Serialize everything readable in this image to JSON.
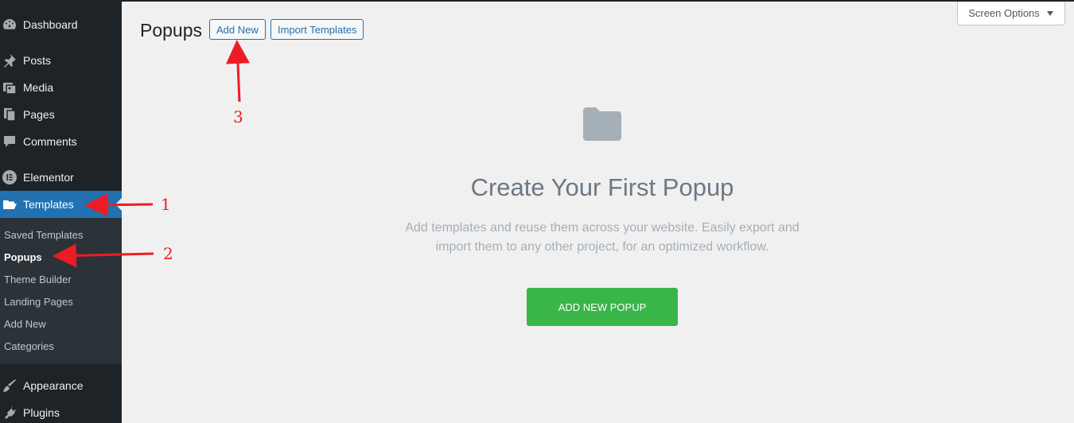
{
  "sidebar": {
    "items": [
      {
        "label": "Dashboard",
        "icon": "dashboard-icon"
      },
      {
        "label": "Posts",
        "icon": "pin-icon"
      },
      {
        "label": "Media",
        "icon": "media-icon"
      },
      {
        "label": "Pages",
        "icon": "pages-icon"
      },
      {
        "label": "Comments",
        "icon": "comment-icon"
      },
      {
        "label": "Elementor",
        "icon": "elementor-icon"
      },
      {
        "label": "Templates",
        "icon": "folder-open-icon",
        "active": true
      },
      {
        "label": "Appearance",
        "icon": "paintbrush-icon"
      },
      {
        "label": "Plugins",
        "icon": "plug-icon"
      }
    ],
    "submenu": [
      {
        "label": "Saved Templates"
      },
      {
        "label": "Popups",
        "current": true
      },
      {
        "label": "Theme Builder"
      },
      {
        "label": "Landing Pages"
      },
      {
        "label": "Add New"
      },
      {
        "label": "Categories"
      }
    ]
  },
  "header": {
    "title": "Popups",
    "add_new_label": "Add New",
    "import_label": "Import Templates",
    "screen_options_label": "Screen Options"
  },
  "empty_state": {
    "icon": "folder-icon",
    "title": "Create Your First Popup",
    "description_line1": "Add templates and reuse them across your website. Easily export and",
    "description_line2": "import them to any other project, for an optimized workflow.",
    "cta_label": "ADD NEW POPUP"
  },
  "annotations": {
    "one": "1",
    "two": "2",
    "three": "3",
    "color": "#ed1c24"
  },
  "colors": {
    "sidebar_bg": "#1d2327",
    "submenu_bg": "#2c3338",
    "active_bg": "#2271b1",
    "cta_bg": "#39b54a",
    "page_bg": "#f0f0f1"
  }
}
